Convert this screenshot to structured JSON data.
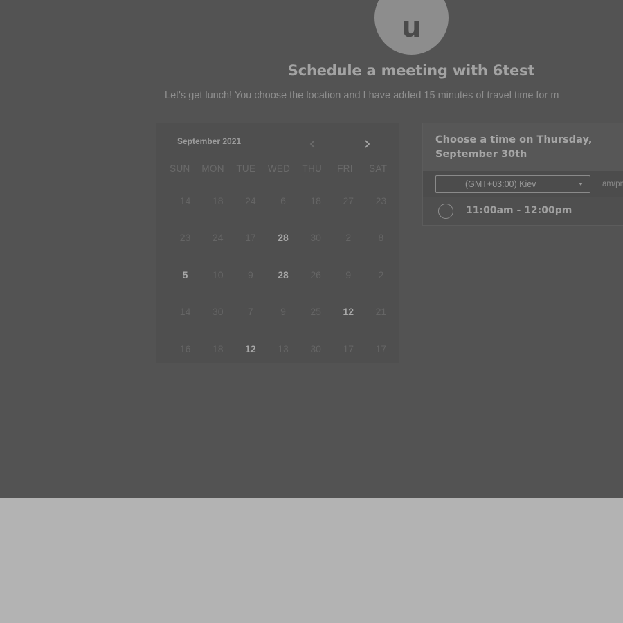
{
  "avatar": {
    "initial": "u"
  },
  "title": "Schedule a meeting with 6test",
  "subtitle": "Let's get lunch! You choose the location and I have added 15 minutes of travel time for m",
  "calendar": {
    "month_label": "September 2021",
    "prev_icon": "chevron-left-icon",
    "next_icon": "chevron-right-icon",
    "weekdays": [
      "SUN",
      "MON",
      "TUE",
      "WED",
      "THU",
      "FRI",
      "SAT"
    ],
    "weeks": [
      [
        {
          "d": "14",
          "a": false
        },
        {
          "d": "18",
          "a": false
        },
        {
          "d": "24",
          "a": false
        },
        {
          "d": "6",
          "a": false
        },
        {
          "d": "18",
          "a": false
        },
        {
          "d": "27",
          "a": false
        },
        {
          "d": "23",
          "a": false
        }
      ],
      [
        {
          "d": "23",
          "a": false
        },
        {
          "d": "24",
          "a": false
        },
        {
          "d": "17",
          "a": false
        },
        {
          "d": "28",
          "a": true
        },
        {
          "d": "30",
          "a": false
        },
        {
          "d": "2",
          "a": false
        },
        {
          "d": "8",
          "a": false
        }
      ],
      [
        {
          "d": "5",
          "a": true
        },
        {
          "d": "10",
          "a": false
        },
        {
          "d": "9",
          "a": false
        },
        {
          "d": "28",
          "a": true
        },
        {
          "d": "26",
          "a": false
        },
        {
          "d": "9",
          "a": false
        },
        {
          "d": "2",
          "a": false
        }
      ],
      [
        {
          "d": "14",
          "a": false
        },
        {
          "d": "30",
          "a": false
        },
        {
          "d": "7",
          "a": false
        },
        {
          "d": "9",
          "a": false
        },
        {
          "d": "25",
          "a": false
        },
        {
          "d": "12",
          "a": true
        },
        {
          "d": "21",
          "a": false
        }
      ],
      [
        {
          "d": "16",
          "a": false
        },
        {
          "d": "18",
          "a": false
        },
        {
          "d": "12",
          "a": true
        },
        {
          "d": "13",
          "a": false
        },
        {
          "d": "30",
          "a": false
        },
        {
          "d": "17",
          "a": false
        },
        {
          "d": "17",
          "a": false
        }
      ]
    ]
  },
  "time_panel": {
    "heading": "Choose a time on Thursday, September 30th",
    "timezone_value": "(GMT+03:00) Kiev",
    "format_toggle": "am/pm",
    "slots": [
      {
        "label": "11:00am - 12:00pm"
      }
    ]
  },
  "colors": {
    "overlay": "#535353",
    "bottom": "#b3b3b3"
  }
}
